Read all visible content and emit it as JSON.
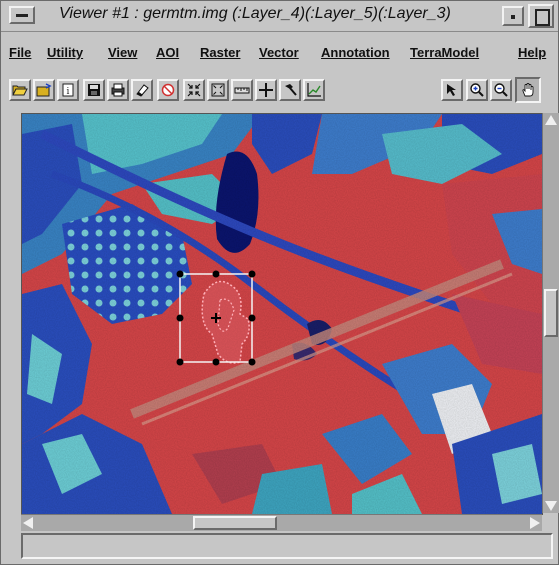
{
  "window": {
    "title": "Viewer #1 : germtm.img (:Layer_4)(:Layer_5)(:Layer_3)"
  },
  "menu": [
    {
      "label": "File",
      "name": "file"
    },
    {
      "label": "Utility",
      "name": "utility"
    },
    {
      "label": "View",
      "name": "view"
    },
    {
      "label": "AOI",
      "name": "aoi"
    },
    {
      "label": "Raster",
      "name": "raster"
    },
    {
      "label": "Vector",
      "name": "vector"
    },
    {
      "label": "Annotation",
      "name": "annotation"
    },
    {
      "label": "TerraModel",
      "name": "terramodel"
    },
    {
      "label": "Help",
      "name": "help"
    }
  ],
  "toolbar": [
    {
      "icon": "open-folder-icon"
    },
    {
      "icon": "open-layer-icon"
    },
    {
      "icon": "info-icon"
    },
    {
      "icon": "save-icon"
    },
    {
      "icon": "print-icon"
    },
    {
      "icon": "eraser-icon"
    },
    {
      "icon": "clear-view-icon"
    },
    {
      "icon": "zoom-in-inward-icon"
    },
    {
      "icon": "fit-to-window-icon"
    },
    {
      "icon": "measure-icon"
    },
    {
      "icon": "crosshair-icon"
    },
    {
      "icon": "hammer-icon"
    },
    {
      "icon": "profile-icon"
    },
    {
      "icon": "select-pointer-icon"
    },
    {
      "icon": "zoom-in-icon"
    },
    {
      "icon": "zoom-out-icon"
    },
    {
      "icon": "pan-hand-icon",
      "active": true
    }
  ],
  "colors": {
    "raster_red": "#d9474a",
    "raster_cyan": "#3fb8c8",
    "raster_blue": "#2b4fc0",
    "water_dark": "#0b1570",
    "selection_black": "#000000"
  },
  "status": {
    "text": ""
  }
}
